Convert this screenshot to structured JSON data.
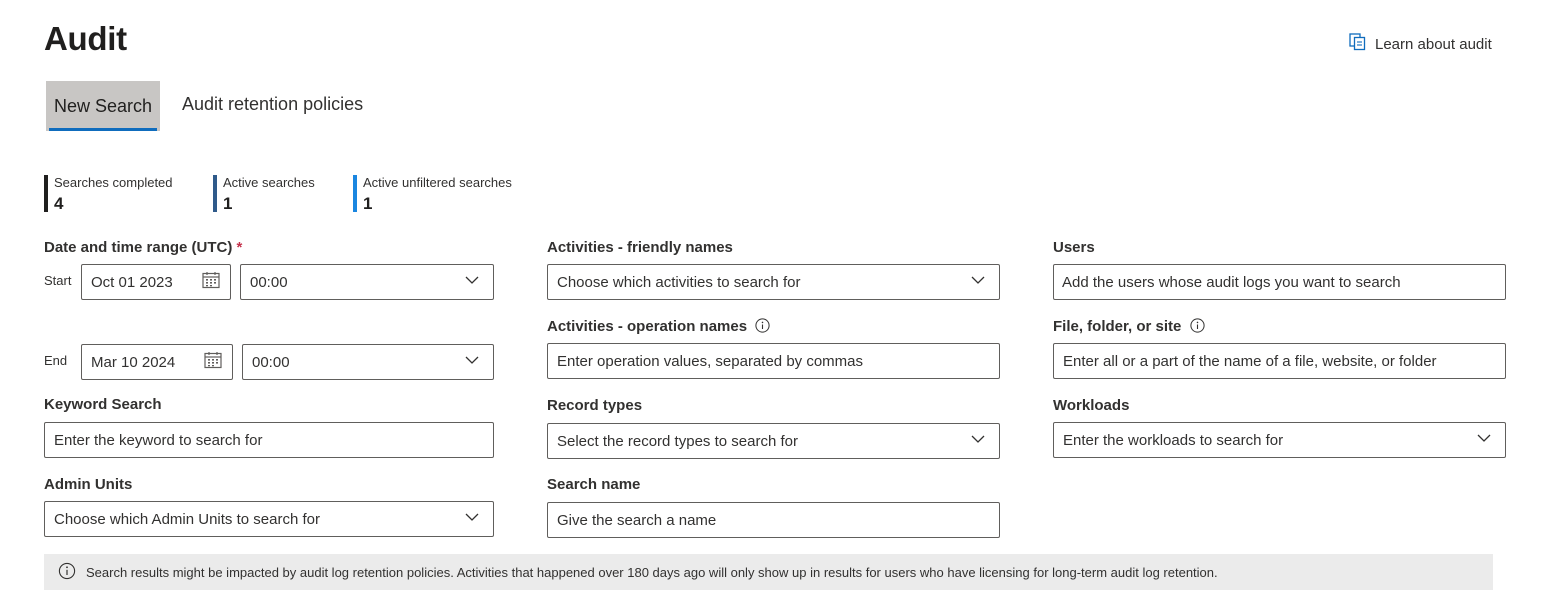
{
  "header": {
    "title": "Audit",
    "learn_link": "Learn about audit"
  },
  "tabs": [
    {
      "label": "New Search",
      "selected": true
    },
    {
      "label": "Audit retention policies",
      "selected": false
    }
  ],
  "stats": [
    {
      "label": "Searches completed",
      "value": "4",
      "color": "#201f1e"
    },
    {
      "label": "Active searches",
      "value": "1",
      "color": "#2f5a8a"
    },
    {
      "label": "Active unfiltered searches",
      "value": "1",
      "color": "#1a86e0"
    }
  ],
  "date_range": {
    "label": "Date and time range (UTC)",
    "required_mark": "*",
    "start_label": "Start",
    "start_date": "Oct 01 2023",
    "start_time": "00:00",
    "end_label": "End",
    "end_date": "Mar 10 2024",
    "end_time": "00:00"
  },
  "keyword": {
    "label": "Keyword Search",
    "placeholder": "Enter the keyword to search for"
  },
  "admin_units": {
    "label": "Admin Units",
    "placeholder": "Choose which Admin Units to search for"
  },
  "activities_friendly": {
    "label": "Activities - friendly names",
    "placeholder": "Choose which activities to search for"
  },
  "activities_operation": {
    "label": "Activities - operation names",
    "placeholder": "Enter operation values, separated by commas"
  },
  "record_types": {
    "label": "Record types",
    "placeholder": "Select the record types to search for"
  },
  "search_name": {
    "label": "Search name",
    "placeholder": "Give the search a name"
  },
  "users": {
    "label": "Users",
    "placeholder": "Add the users whose audit logs you want to search"
  },
  "file_folder_site": {
    "label": "File, folder, or site",
    "placeholder": "Enter all or a part of the name of a file, website, or folder"
  },
  "workloads": {
    "label": "Workloads",
    "placeholder": "Enter the workloads to search for"
  },
  "notice": {
    "text": "Search results might be impacted by audit log retention policies. Activities that happened over 180 days ago will only show up in results for users who have licensing for long-term audit log retention."
  },
  "colors": {
    "accent": "#0f6cbd",
    "selected_tab_bg": "#c8c6c4",
    "required": "#c4314b"
  }
}
